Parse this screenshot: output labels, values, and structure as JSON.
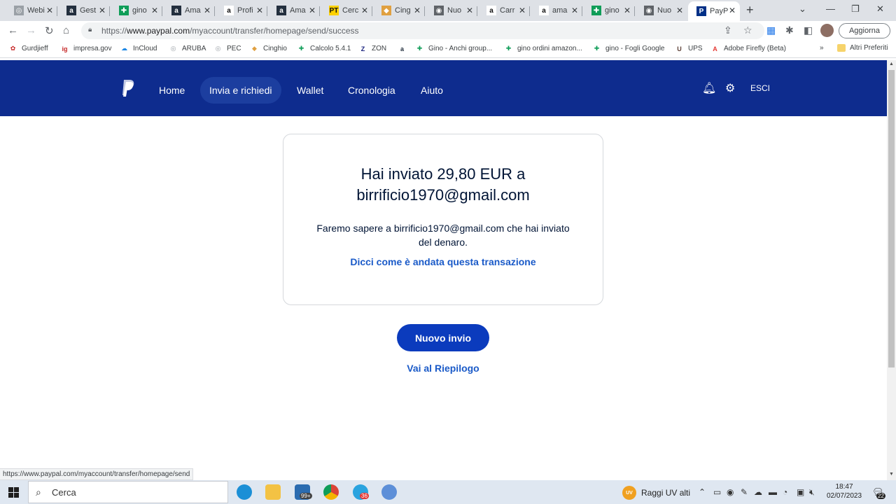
{
  "browser": {
    "tabs": [
      {
        "label": "Webi",
        "favicon": "page-icon",
        "color": "#9aa0a6",
        "glyph": "◎"
      },
      {
        "label": "Gest",
        "favicon": "amazon-icon",
        "color": "#232f3e",
        "glyph": "a"
      },
      {
        "label": "gino",
        "favicon": "sheets-icon",
        "color": "#0f9d58",
        "glyph": "✚"
      },
      {
        "label": "Ama",
        "favicon": "amazon-icon",
        "color": "#232f3e",
        "glyph": "a"
      },
      {
        "label": "Profi",
        "favicon": "amazon-icon",
        "color": "#ffffff",
        "glyph": "a"
      },
      {
        "label": "Ama",
        "favicon": "amazon-icon",
        "color": "#232f3e",
        "glyph": "a"
      },
      {
        "label": "Cerc",
        "favicon": "poste-icon",
        "color": "#ffd100",
        "glyph": "PT"
      },
      {
        "label": "Cing",
        "favicon": "cinghio-icon",
        "color": "#e0a040",
        "glyph": "◆"
      },
      {
        "label": "Nuo",
        "favicon": "chrome-icon",
        "color": "#5f6368",
        "glyph": "◉"
      },
      {
        "label": "Carr",
        "favicon": "amazon-icon",
        "color": "#ffffff",
        "glyph": "a"
      },
      {
        "label": "ama",
        "favicon": "amazon-icon",
        "color": "#ffffff",
        "glyph": "a"
      },
      {
        "label": "gino",
        "favicon": "sheets-icon",
        "color": "#0f9d58",
        "glyph": "✚"
      },
      {
        "label": "Nuo",
        "favicon": "chrome-icon",
        "color": "#5f6368",
        "glyph": "◉"
      },
      {
        "label": "PayP",
        "favicon": "paypal-icon",
        "color": "#003087",
        "glyph": "P"
      }
    ],
    "url_prefix": "https://",
    "url_host": "www.paypal.com",
    "url_path": "/myaccount/transfer/homepage/send/success",
    "update_button": "Aggiorna",
    "bookmarks": [
      {
        "label": "Gurdjieff",
        "glyph": "✿",
        "color": "#c62828"
      },
      {
        "label": "impresa.gov",
        "glyph": "ig",
        "color": "#c62828"
      },
      {
        "label": "InCloud",
        "glyph": "☁",
        "color": "#1e88e5"
      },
      {
        "label": "ARUBA",
        "glyph": "◎",
        "color": "#9aa0a6"
      },
      {
        "label": "PEC",
        "glyph": "◎",
        "color": "#9aa0a6"
      },
      {
        "label": "Cinghio",
        "glyph": "◆",
        "color": "#e0a040"
      },
      {
        "label": "Calcolo 5.4.1",
        "glyph": "✚",
        "color": "#0f9d58"
      },
      {
        "label": "ZON",
        "glyph": "Z",
        "color": "#1a237e"
      },
      {
        "label": "",
        "glyph": "a",
        "color": "#232f3e"
      },
      {
        "label": "Gino - Anchi group...",
        "glyph": "✚",
        "color": "#0f9d58"
      },
      {
        "label": "gino ordini amazon...",
        "glyph": "✚",
        "color": "#0f9d58"
      },
      {
        "label": "gino - Fogli Google",
        "glyph": "✚",
        "color": "#0f9d58"
      },
      {
        "label": "UPS",
        "glyph": "U",
        "color": "#5d4037"
      },
      {
        "label": "Adobe Firefly (Beta)",
        "glyph": "A",
        "color": "#e53935"
      }
    ],
    "bookmarks_overflow": "»",
    "other_bookmarks": "Altri Preferiti",
    "status_url": "https://www.paypal.com/myaccount/transfer/homepage/send"
  },
  "paypal": {
    "nav": [
      "Home",
      "Invia e richiedi",
      "Wallet",
      "Cronologia",
      "Aiuto"
    ],
    "active_nav": "Invia e richiedi",
    "logout": "ESCI",
    "title_line1": "Hai inviato 29,80 EUR a",
    "title_line2": "birrificio1970@gmail.com",
    "message": "Faremo sapere a birrificio1970@gmail.com che hai inviato del denaro.",
    "feedback_link": "Dicci come è andata questa transazione",
    "new_send_button": "Nuovo invio",
    "summary_link": "Vai al Riepilogo",
    "colors": {
      "header": "#0e2c8e",
      "button": "#0b3bbd",
      "link": "#1a5ac8"
    }
  },
  "taskbar": {
    "search_placeholder": "Cerca",
    "mail_badge": "99+",
    "telegram_badge": "36",
    "weather": "Raggi UV alti",
    "weather_badge": "UV",
    "time": "18:47",
    "date": "02/07/2023",
    "notifications": "22"
  }
}
